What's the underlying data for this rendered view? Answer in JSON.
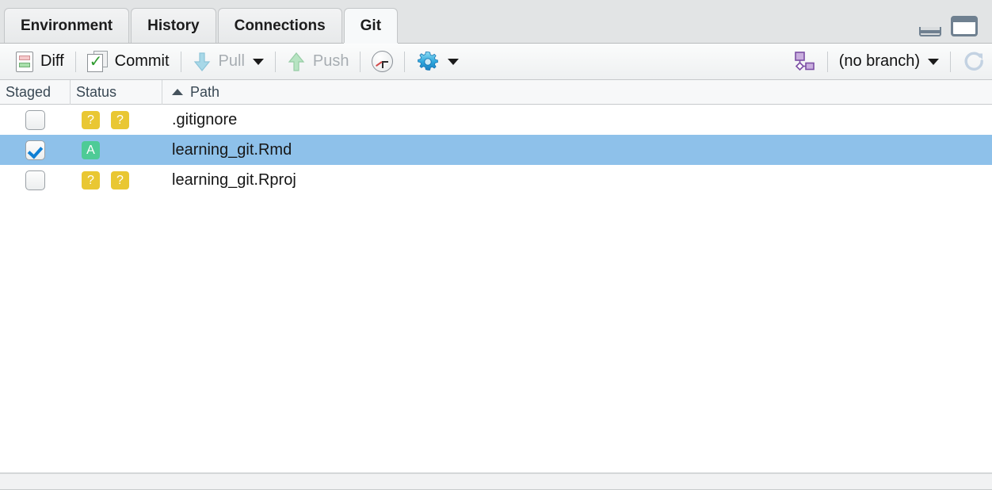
{
  "window": {
    "minimize_icon": "minimize-icon",
    "maximize_icon": "maximize-icon"
  },
  "tabs": [
    {
      "label": "Environment",
      "active": false
    },
    {
      "label": "History",
      "active": false
    },
    {
      "label": "Connections",
      "active": false
    },
    {
      "label": "Git",
      "active": true
    }
  ],
  "toolbar": {
    "diff_label": "Diff",
    "diff_icon": "diff-icon",
    "commit_label": "Commit",
    "commit_icon": "commit-icon",
    "pull_label": "Pull",
    "pull_icon": "pull-arrow-down-icon",
    "pull_dropdown_icon": "chevron-down-icon",
    "push_label": "Push",
    "push_icon": "push-arrow-up-icon",
    "history_icon": "clock-icon",
    "gear_icon": "gear-icon",
    "gear_dropdown_icon": "chevron-down-icon",
    "branch_icon": "branch-icon",
    "branch_label": "(no branch)",
    "branch_dropdown_icon": "chevron-down-icon",
    "refresh_icon": "refresh-icon"
  },
  "table": {
    "columns": {
      "staged": "Staged",
      "status": "Status",
      "path": "Path",
      "sort_icon": "sort-ascending-icon"
    },
    "rows": [
      {
        "staged": false,
        "status_left": "?",
        "status_right": "?",
        "status_left_kind": "untracked",
        "status_right_kind": "untracked",
        "path": ".gitignore",
        "selected": false
      },
      {
        "staged": true,
        "status_left": "A",
        "status_right": "",
        "status_left_kind": "added",
        "status_right_kind": "blank",
        "path": "learning_git.Rmd",
        "selected": true
      },
      {
        "staged": false,
        "status_left": "?",
        "status_right": "?",
        "status_left_kind": "untracked",
        "status_right_kind": "untracked",
        "path": "learning_git.Rproj",
        "selected": false
      }
    ]
  },
  "colors": {
    "selection": "#8ec1ea",
    "untracked_badge": "#e9c733",
    "added_badge": "#4ecb96",
    "accent_checkbox": "#0f7fd4",
    "branch_icon": "#8f63b5"
  }
}
